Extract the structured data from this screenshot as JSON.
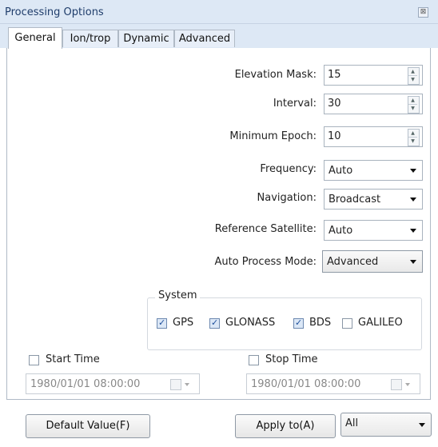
{
  "window": {
    "title": "Processing Options",
    "close_icon": "⊠"
  },
  "tabs": [
    {
      "label": "General",
      "active": true
    },
    {
      "label": "Ion/trop",
      "active": false
    },
    {
      "label": "Dynamic",
      "active": false
    },
    {
      "label": "Advanced",
      "active": false
    }
  ],
  "fields": {
    "elevation_mask": {
      "label": "Elevation Mask:",
      "value": "15"
    },
    "interval": {
      "label": "Interval:",
      "value": "30"
    },
    "minimum_epoch": {
      "label": "Minimum Epoch:",
      "value": "10"
    },
    "frequency": {
      "label": "Frequency:",
      "value": "Auto"
    },
    "navigation": {
      "label": "Navigation:",
      "value": "Broadcast"
    },
    "reference_satellite": {
      "label": "Reference Satellite:",
      "value": "Auto"
    },
    "auto_process_mode": {
      "label": "Auto Process Mode:",
      "value": "Advanced"
    }
  },
  "system": {
    "title": "System",
    "items": [
      {
        "label": "GPS",
        "checked": true
      },
      {
        "label": "GLONASS",
        "checked": true
      },
      {
        "label": "BDS",
        "checked": true
      },
      {
        "label": "GALILEO",
        "checked": false
      }
    ]
  },
  "start_time": {
    "label": "Start Time",
    "checked": false,
    "value": "1980/01/01 08:00:00"
  },
  "stop_time": {
    "label": "Stop Time",
    "checked": false,
    "value": "1980/01/01 08:00:00"
  },
  "buttons": {
    "default_value": "Default Value(F)",
    "apply_to": "Apply to(A)",
    "apply_target": "All"
  }
}
